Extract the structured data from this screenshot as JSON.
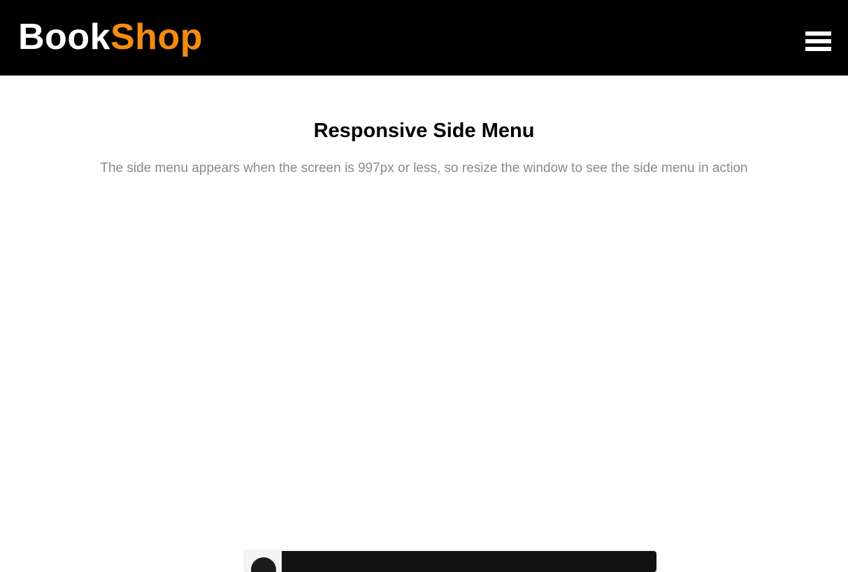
{
  "header": {
    "logo": {
      "part1": "Book",
      "part2": "Shop"
    },
    "menu_icon": "hamburger-menu-icon"
  },
  "main": {
    "title": "Responsive Side Menu",
    "description": "The side menu appears when the screen is 997px or less, so resize the window to see the side menu in action"
  },
  "colors": {
    "header_bg": "#000000",
    "logo_primary": "#ffffff",
    "logo_accent": "#f28c0f",
    "description_text": "#8a8a8a"
  }
}
